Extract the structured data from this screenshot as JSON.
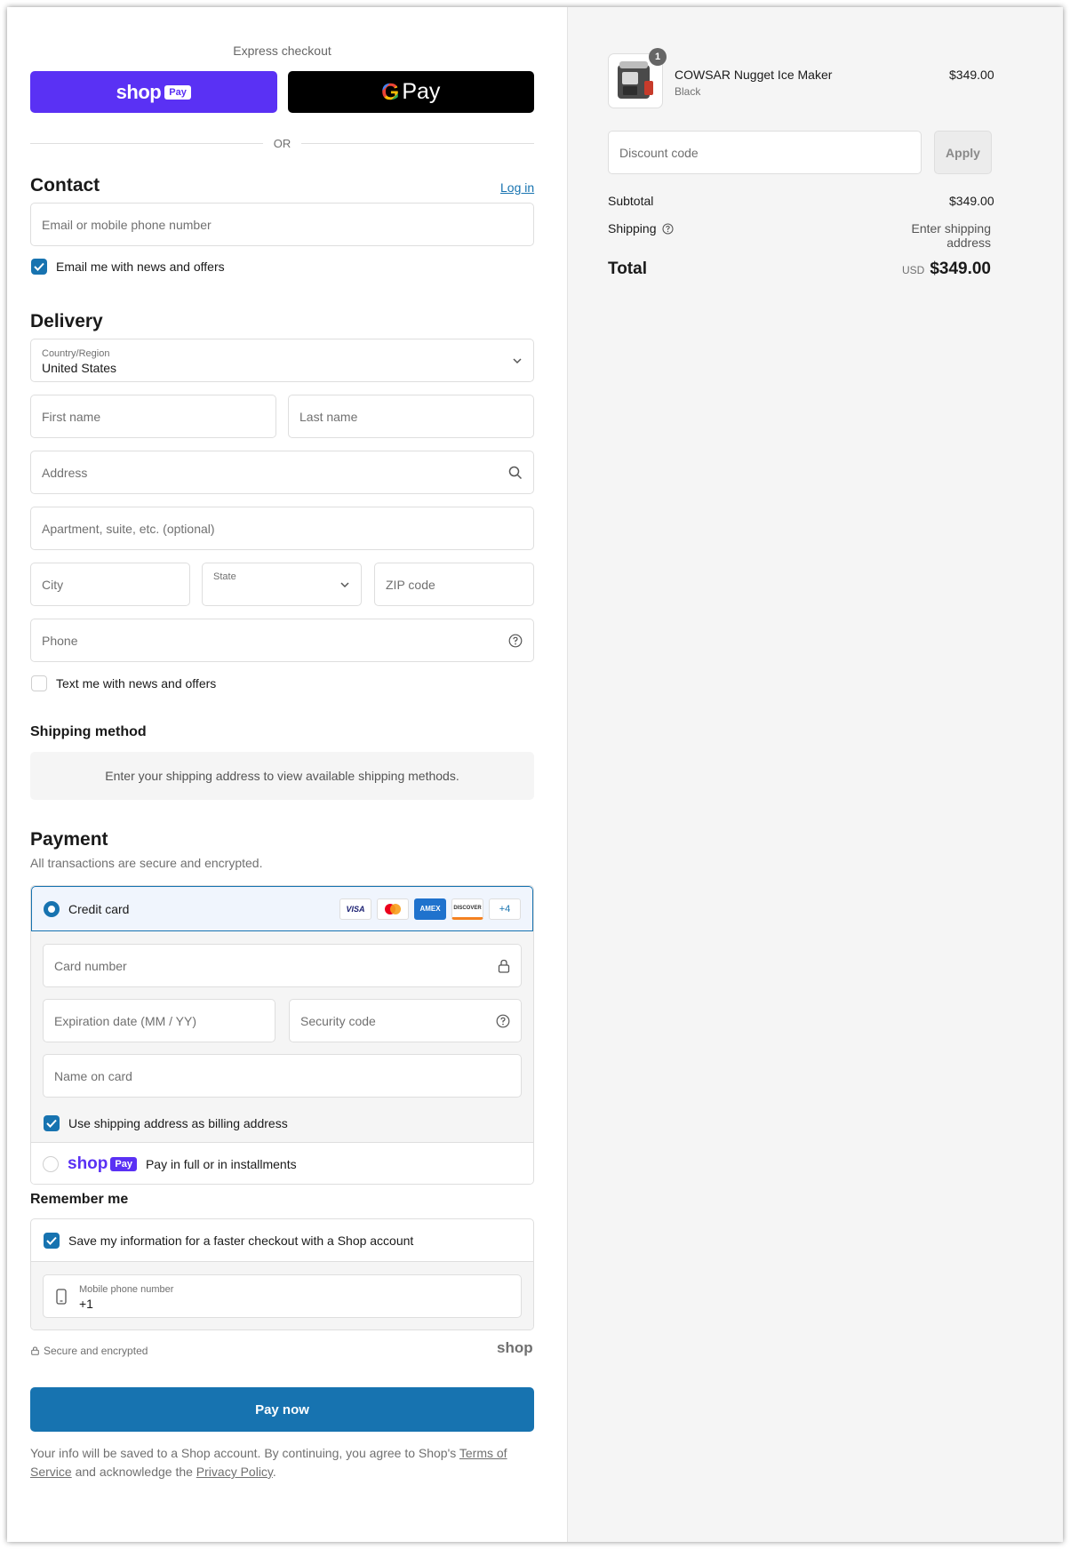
{
  "express": {
    "title": "Express checkout",
    "shop_word": "shop",
    "shop_pill": "Pay",
    "gpay_g": "G",
    "gpay_label": "Pay"
  },
  "or_label": "OR",
  "contact": {
    "title": "Contact",
    "login_link": "Log in",
    "email_placeholder": "Email or mobile phone number",
    "news_label": "Email me with news and offers",
    "news_checked": true
  },
  "delivery": {
    "title": "Delivery",
    "country_label": "Country/Region",
    "country_value": "United States",
    "first_name": "First name",
    "last_name": "Last name",
    "address": "Address",
    "apartment": "Apartment, suite, etc. (optional)",
    "city": "City",
    "state_label": "State",
    "zip": "ZIP code",
    "phone": "Phone",
    "text_label": "Text me with news and offers",
    "text_checked": false
  },
  "shipping_method": {
    "title": "Shipping method",
    "message": "Enter your shipping address to view available shipping methods."
  },
  "payment": {
    "title": "Payment",
    "subtitle": "All transactions are secure and encrypted.",
    "credit_card_label": "Credit card",
    "card_logos": [
      "VISA",
      "MC",
      "AMEX",
      "DISCOVER"
    ],
    "more_cards": "+4",
    "card_number": "Card number",
    "expiration": "Expiration date (MM / YY)",
    "security_code": "Security code",
    "name_on_card": "Name on card",
    "billing_label": "Use shipping address as billing address",
    "billing_checked": true,
    "shop_pay_word": "shop",
    "shop_pay_pill": "Pay",
    "shop_pay_label": "Pay in full or in installments"
  },
  "remember": {
    "title": "Remember me",
    "save_label": "Save my information for a faster checkout with a Shop account",
    "save_checked": true,
    "mobile_label": "Mobile phone number",
    "mobile_value": "+1"
  },
  "secure_label": "Secure and encrypted",
  "shop_footer_logo": "shop",
  "pay_now": "Pay now",
  "legal": {
    "part1": "Your info will be saved to a Shop account. By continuing, you agree to Shop's ",
    "terms": "Terms of Service",
    "part2": " and acknowledge the ",
    "privacy": "Privacy Policy",
    "end": "."
  },
  "summary": {
    "product_name": "COWSAR Nugget Ice Maker",
    "product_variant": "Black",
    "product_price": "$349.00",
    "quantity": "1",
    "discount_placeholder": "Discount code",
    "apply_label": "Apply",
    "subtotal_label": "Subtotal",
    "subtotal_value": "$349.00",
    "shipping_label": "Shipping",
    "shipping_value": "Enter shipping address",
    "total_label": "Total",
    "currency": "USD",
    "total_value": "$349.00"
  },
  "colors": {
    "accent": "#1773b0",
    "shop_purple": "#5a31f4",
    "panel_bg": "#f5f5f5"
  }
}
